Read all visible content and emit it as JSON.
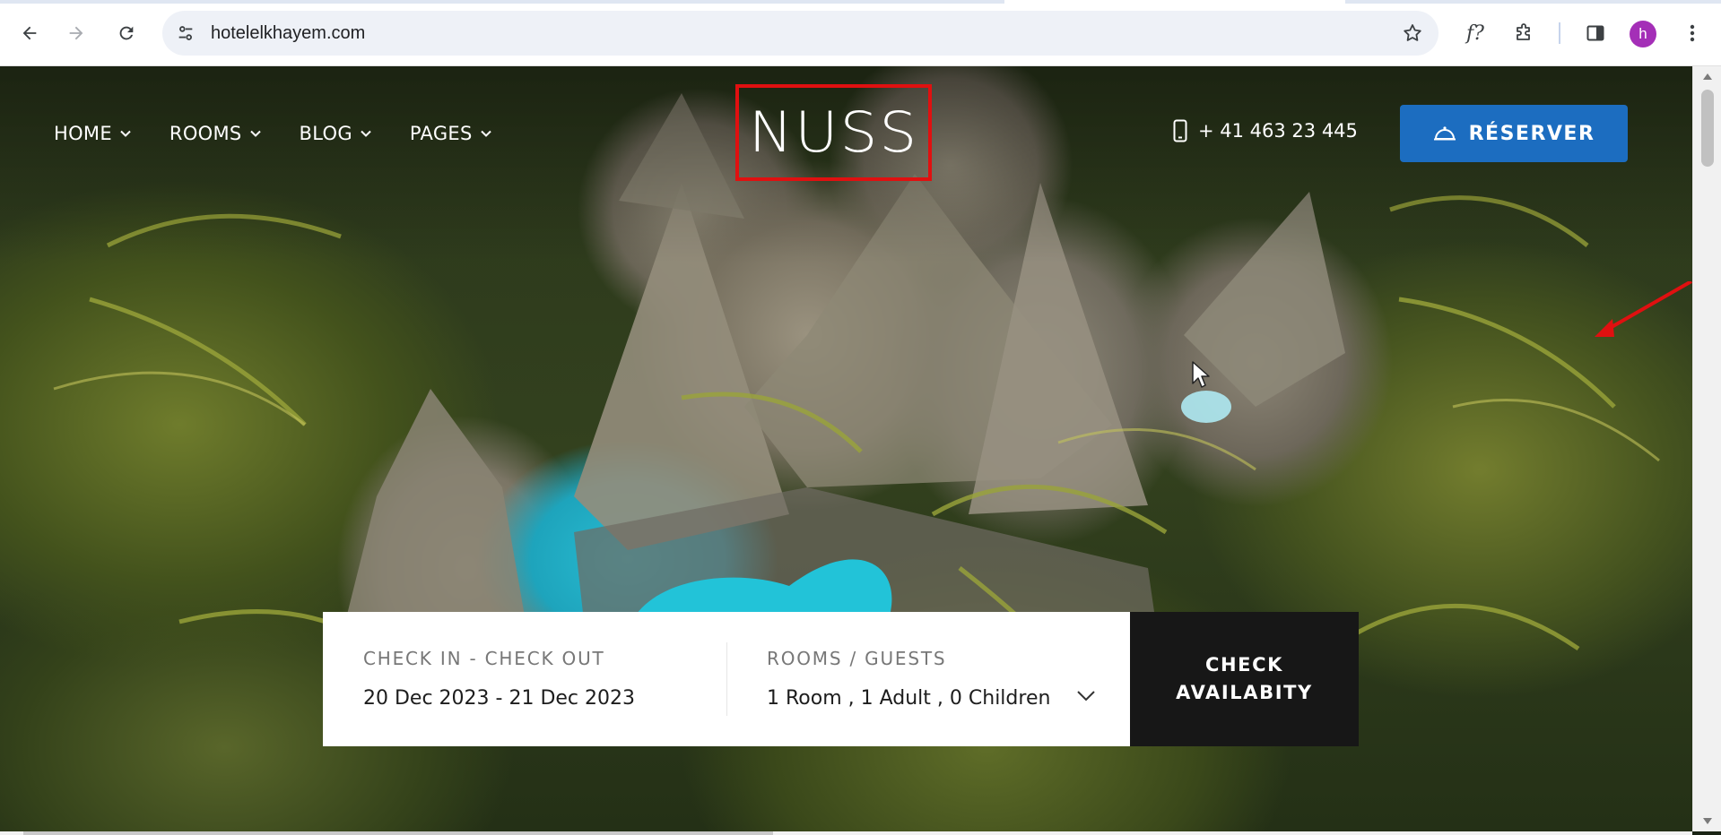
{
  "browser": {
    "url": "hotelelkhayem.com",
    "profile_initial": "h",
    "icons": {
      "back": "arrow-left-icon",
      "forward": "arrow-right-icon",
      "reload": "reload-icon",
      "site_info": "tune-icon",
      "bookmark": "star-icon",
      "formula_ext": "fx-icon",
      "extensions": "puzzle-icon",
      "side_panel": "side-panel-icon",
      "menu": "kebab-menu-icon"
    },
    "formula_ext_label": "f?"
  },
  "site": {
    "logo": "NUSS",
    "nav": [
      {
        "label": "HOME"
      },
      {
        "label": "ROOMS"
      },
      {
        "label": "BLOG"
      },
      {
        "label": "PAGES"
      }
    ],
    "phone": "+ 41 463 23 445",
    "reserve_label": "RÉSERVER",
    "accent_color": "#1c6dc0",
    "annotation_color": "#e01010"
  },
  "booking": {
    "dates_label": "CHECK IN - CHECK OUT",
    "dates_value": "20 Dec 2023 - 21 Dec 2023",
    "rooms_label": "ROOMS / GUESTS",
    "rooms_value": "1 Room , 1 Adult , 0 Children",
    "cta_line1": "CHECK",
    "cta_line2": "AVAILABITY"
  }
}
